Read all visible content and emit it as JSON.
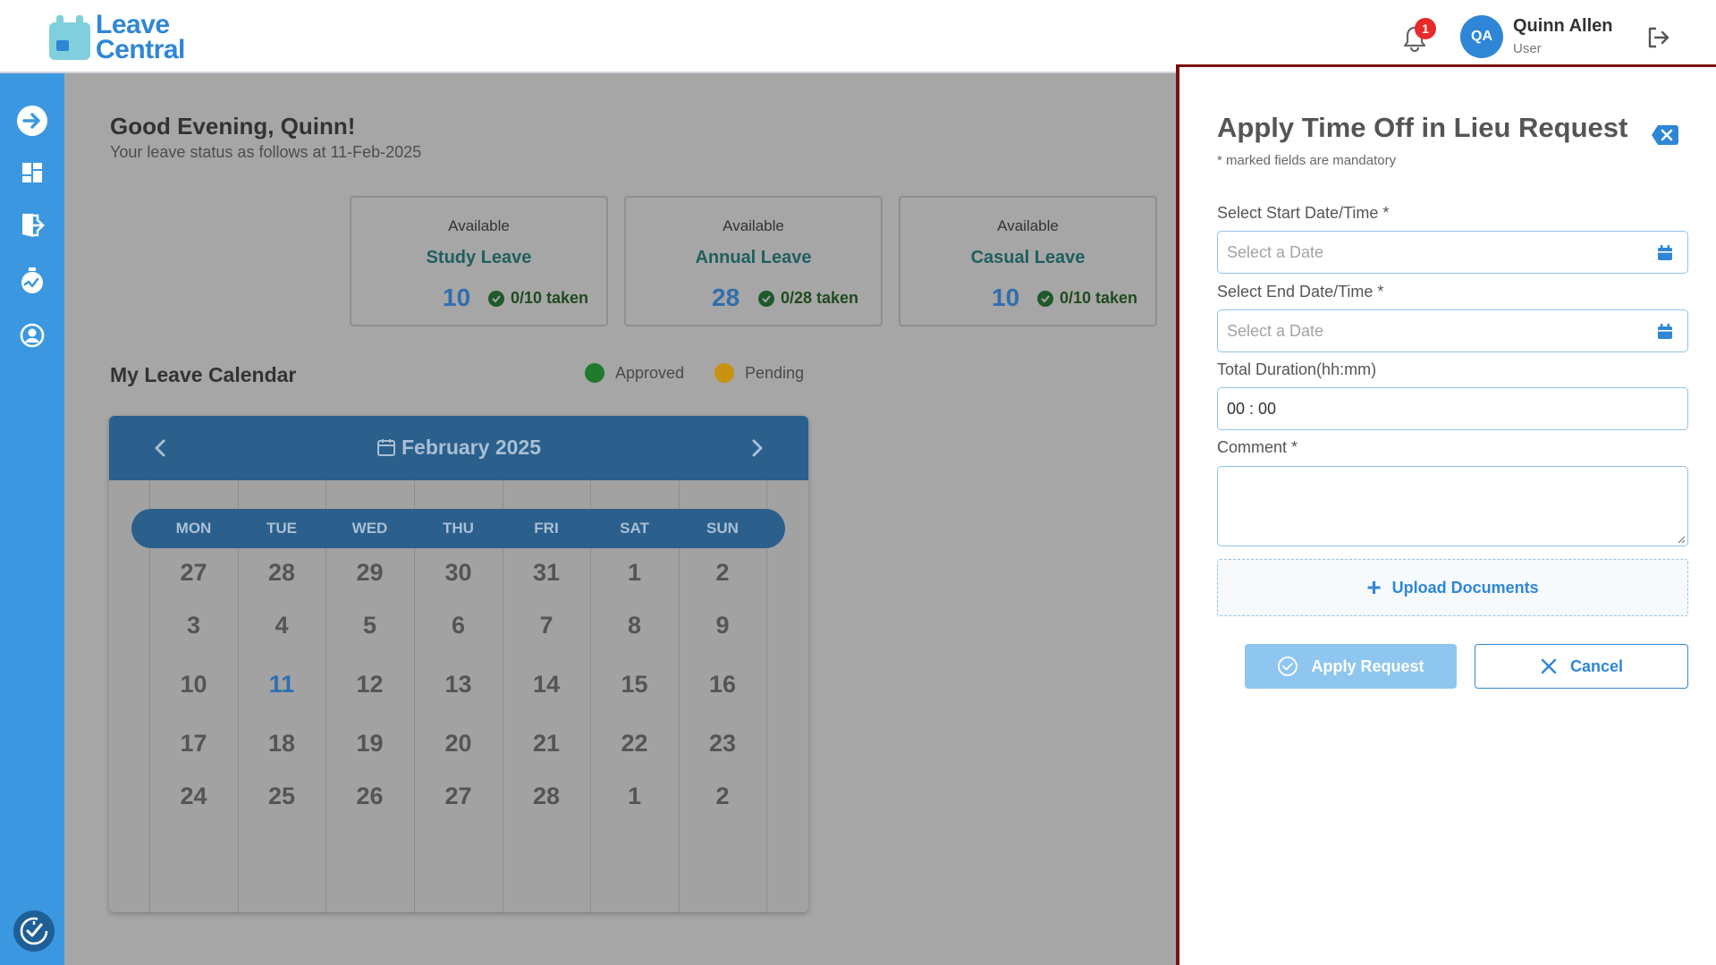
{
  "app": {
    "logo_line1": "Leave",
    "logo_line2": "Central"
  },
  "header": {
    "notification_count": "1",
    "user_initials": "QA",
    "user_name": "Quinn Allen",
    "user_role": "User"
  },
  "sidebar": {
    "items": [
      {
        "icon": "arrow-right-circle-icon"
      },
      {
        "icon": "dashboard-icon"
      },
      {
        "icon": "leave-exit-icon"
      },
      {
        "icon": "time-off-icon"
      },
      {
        "icon": "profile-icon"
      },
      {
        "icon": "clock-check-icon"
      }
    ]
  },
  "dashboard": {
    "greeting": "Good Evening, Quinn!",
    "status_line": "Your leave status as follows at 11-Feb-2025",
    "cards": [
      {
        "available_label": "Available",
        "type": "Study Leave",
        "count": "10",
        "taken": "0/10 taken"
      },
      {
        "available_label": "Available",
        "type": "Annual Leave",
        "count": "28",
        "taken": "0/28 taken"
      },
      {
        "available_label": "Available",
        "type": "Casual Leave",
        "count": "10",
        "taken": "0/10 taken"
      }
    ],
    "calendar_title": "My Leave Calendar",
    "legend": [
      {
        "label": "Approved",
        "color": "#1f7a2e"
      },
      {
        "label": "Pending",
        "color": "#c8910f"
      }
    ]
  },
  "calendar": {
    "month_label": "February 2025",
    "weekdays": [
      "MON",
      "TUE",
      "WED",
      "THU",
      "FRI",
      "SAT",
      "SUN"
    ],
    "weeks": [
      [
        "27",
        "28",
        "29",
        "30",
        "31",
        "1",
        "2"
      ],
      [
        "3",
        "4",
        "5",
        "6",
        "7",
        "8",
        "9"
      ],
      [
        "10",
        "11",
        "12",
        "13",
        "14",
        "15",
        "16"
      ],
      [
        "17",
        "18",
        "19",
        "20",
        "21",
        "22",
        "23"
      ],
      [
        "24",
        "25",
        "26",
        "27",
        "28",
        "1",
        "2"
      ]
    ],
    "today": "11"
  },
  "form": {
    "title": "Apply Time Off in Lieu Request",
    "subtitle": "* marked fields are mandatory",
    "start_label": "Select Start Date/Time *",
    "start_placeholder": "Select a Date",
    "end_label": "Select End Date/Time *",
    "end_placeholder": "Select a Date",
    "duration_label": "Total Duration(hh:mm)",
    "duration_value": "00 : 00",
    "comment_label": "Comment *",
    "comment_value": "",
    "upload_label": "Upload Documents",
    "apply_label": "Apply Request",
    "cancel_label": "Cancel"
  }
}
